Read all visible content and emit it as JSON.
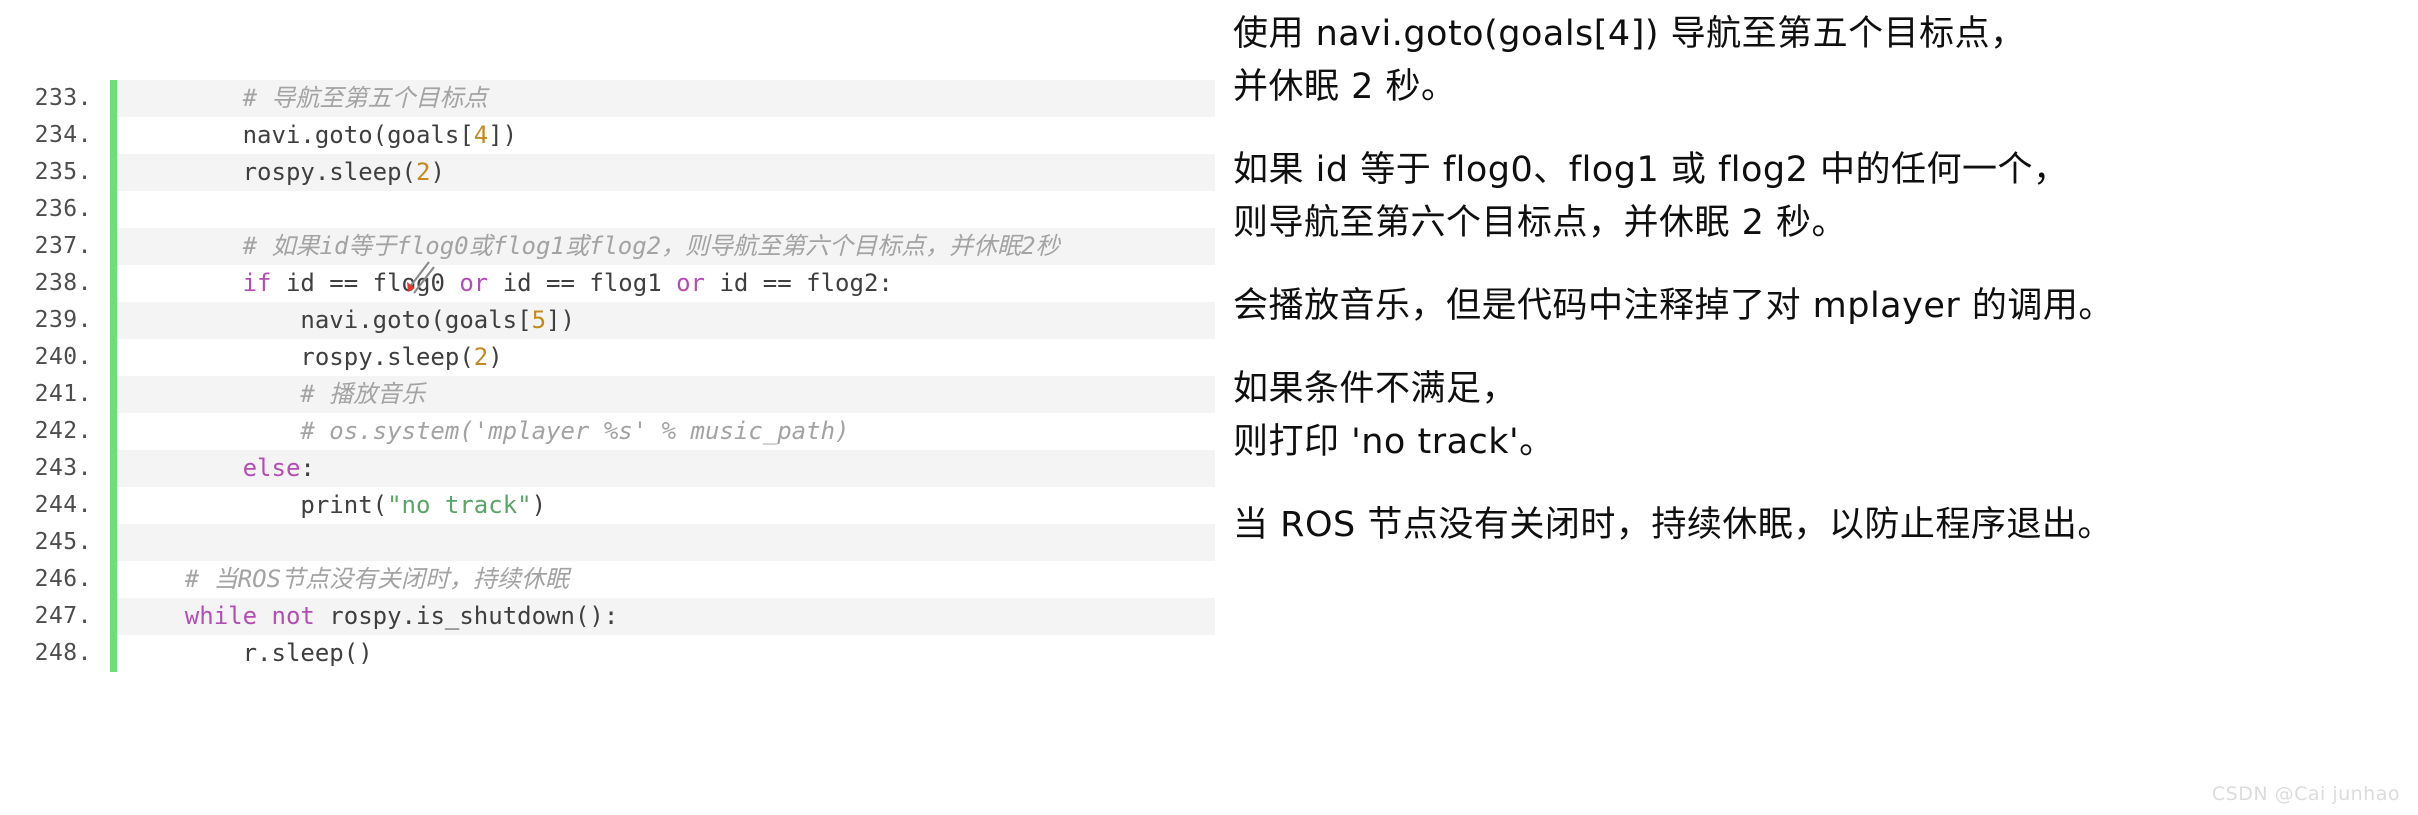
{
  "code_block": {
    "language": "python",
    "gutter_accent_color": "#6ede7a",
    "alt_row_color": "#f4f4f4",
    "colors": {
      "comment": "#a3a3a3",
      "keyword": "#b24fb2",
      "number": "#c38a1e",
      "string": "#5aa469",
      "plain": "#3f3f3f",
      "line_number": "#4d4d4d"
    },
    "lines": [
      {
        "number": "233.",
        "text": "        # 导航至第五个目标点",
        "tokens": [
          {
            "t": "        ",
            "c": "plain"
          },
          {
            "t": "# 导航至第五个目标点",
            "c": "comment"
          }
        ]
      },
      {
        "number": "234.",
        "text": "        navi.goto(goals[4])",
        "tokens": [
          {
            "t": "        navi.goto(goals[",
            "c": "plain"
          },
          {
            "t": "4",
            "c": "number"
          },
          {
            "t": "])",
            "c": "plain"
          }
        ]
      },
      {
        "number": "235.",
        "text": "        rospy.sleep(2)",
        "tokens": [
          {
            "t": "        rospy.sleep(",
            "c": "plain"
          },
          {
            "t": "2",
            "c": "number"
          },
          {
            "t": ")",
            "c": "plain"
          }
        ]
      },
      {
        "number": "236.",
        "text": "",
        "tokens": []
      },
      {
        "number": "237.",
        "text": "        # 如果id等于flog0或flog1或flog2，则导航至第六个目标点，并休眠2秒",
        "tokens": [
          {
            "t": "        ",
            "c": "plain"
          },
          {
            "t": "# 如果id等于flog0或flog1或flog2，则导航至第六个目标点，并休眠2秒",
            "c": "comment"
          }
        ]
      },
      {
        "number": "238.",
        "text": "        if id == flog0 or id == flog1 or id == flog2:",
        "tokens": [
          {
            "t": "        ",
            "c": "plain"
          },
          {
            "t": "if",
            "c": "keyword"
          },
          {
            "t": " id == flog0 ",
            "c": "plain"
          },
          {
            "t": "or",
            "c": "keyword"
          },
          {
            "t": " id == flog1 ",
            "c": "plain"
          },
          {
            "t": "or",
            "c": "keyword"
          },
          {
            "t": " id == flog2:",
            "c": "plain"
          }
        ]
      },
      {
        "number": "239.",
        "text": "            navi.goto(goals[5])",
        "tokens": [
          {
            "t": "            navi.goto(goals[",
            "c": "plain"
          },
          {
            "t": "5",
            "c": "number"
          },
          {
            "t": "])",
            "c": "plain"
          }
        ]
      },
      {
        "number": "240.",
        "text": "            rospy.sleep(2)",
        "tokens": [
          {
            "t": "            rospy.sleep(",
            "c": "plain"
          },
          {
            "t": "2",
            "c": "number"
          },
          {
            "t": ")",
            "c": "plain"
          }
        ]
      },
      {
        "number": "241.",
        "text": "            # 播放音乐",
        "tokens": [
          {
            "t": "            ",
            "c": "plain"
          },
          {
            "t": "# 播放音乐",
            "c": "comment"
          }
        ]
      },
      {
        "number": "242.",
        "text": "            # os.system('mplayer %s' % music_path)",
        "tokens": [
          {
            "t": "            ",
            "c": "plain"
          },
          {
            "t": "# os.system('mplayer %s' % music_path)",
            "c": "comment"
          }
        ]
      },
      {
        "number": "243.",
        "text": "        else:",
        "tokens": [
          {
            "t": "        ",
            "c": "plain"
          },
          {
            "t": "else",
            "c": "keyword"
          },
          {
            "t": ":",
            "c": "plain"
          }
        ]
      },
      {
        "number": "244.",
        "text": "            print(\"no track\")",
        "tokens": [
          {
            "t": "            print(",
            "c": "plain"
          },
          {
            "t": "\"no track\"",
            "c": "string"
          },
          {
            "t": ")",
            "c": "plain"
          }
        ]
      },
      {
        "number": "245.",
        "text": "",
        "tokens": []
      },
      {
        "number": "246.",
        "text": "    # 当ROS节点没有关闭时，持续休眠",
        "tokens": [
          {
            "t": "    ",
            "c": "plain"
          },
          {
            "t": "# 当ROS节点没有关闭时，持续休眠",
            "c": "comment"
          }
        ]
      },
      {
        "number": "247.",
        "text": "    while not rospy.is_shutdown():",
        "tokens": [
          {
            "t": "    ",
            "c": "plain"
          },
          {
            "t": "while",
            "c": "keyword"
          },
          {
            "t": " ",
            "c": "plain"
          },
          {
            "t": "not",
            "c": "keyword"
          },
          {
            "t": " rospy.is_shutdown():",
            "c": "plain"
          }
        ]
      },
      {
        "number": "248.",
        "text": "        r.sleep()",
        "tokens": [
          {
            "t": "        r.sleep()",
            "c": "plain"
          }
        ]
      }
    ]
  },
  "explanation": {
    "paragraphs": [
      "使用 navi.goto(goals[4]) 导航至第五个目标点，\n并休眠 2 秒。",
      "如果 id 等于 flog0、flog1 或 flog2 中的任何一个，\n则导航至第六个目标点，并休眠 2 秒。",
      "会播放音乐，但是代码中注释掉了对 mplayer 的调用。",
      "如果条件不满足，\n则打印 'no track'。",
      "当 ROS 节点没有关闭时，持续休眠，以防止程序退出。"
    ]
  },
  "watermark": {
    "text": "CSDN @Cai junhao"
  }
}
